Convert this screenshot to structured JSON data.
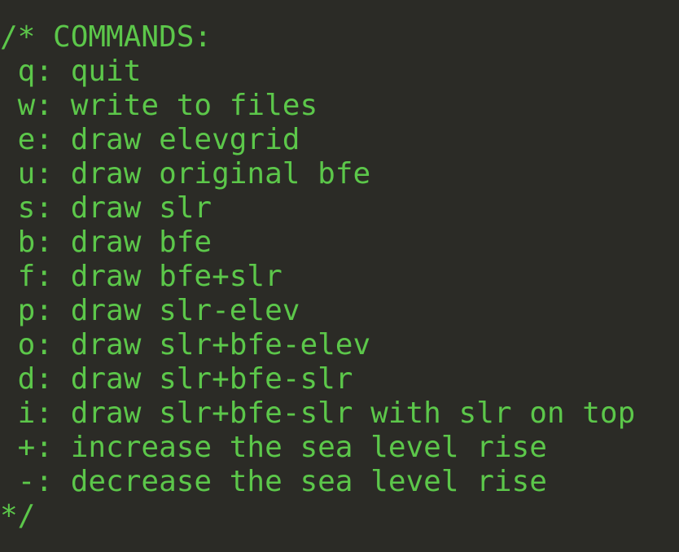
{
  "terminal": {
    "lines": [
      "/* COMMANDS:",
      " q: quit",
      " w: write to files",
      " e: draw elevgrid",
      " u: draw original bfe",
      " s: draw slr",
      " b: draw bfe",
      " f: draw bfe+slr",
      " p: draw slr-elev",
      " o: draw slr+bfe-elev",
      " d: draw slr+bfe-slr",
      " i: draw slr+bfe-slr with slr on top",
      " +: increase the sea level rise",
      " -: decrease the sea level rise",
      "*/"
    ],
    "text_color": "#5cc74a",
    "background_color": "#2b2b26"
  }
}
